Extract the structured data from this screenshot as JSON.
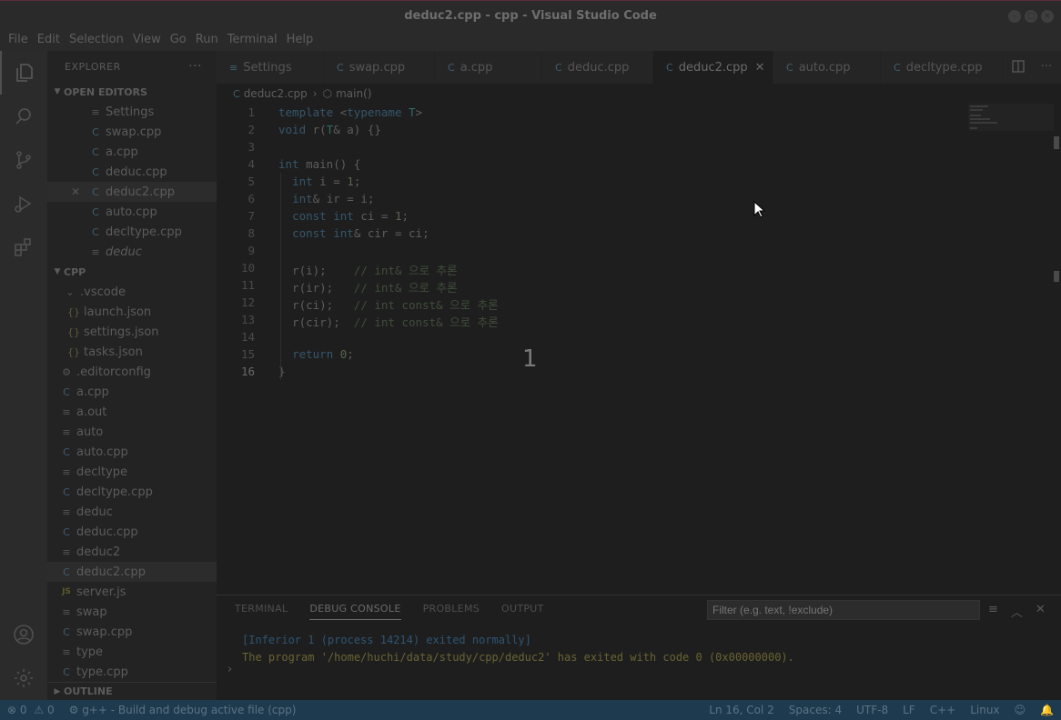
{
  "window": {
    "title": "deduc2.cpp - cpp - Visual Studio Code"
  },
  "menu": [
    "File",
    "Edit",
    "Selection",
    "View",
    "Go",
    "Run",
    "Terminal",
    "Help"
  ],
  "sidebar": {
    "header": "EXPLORER",
    "more": "···",
    "open_editors_title": "OPEN EDITORS",
    "open_editors": [
      {
        "label": "Settings",
        "icon": "settings-file-icon"
      },
      {
        "label": "swap.cpp",
        "icon": "cpp-icon"
      },
      {
        "label": "a.cpp",
        "icon": "cpp-icon"
      },
      {
        "label": "deduc.cpp",
        "icon": "cpp-icon"
      },
      {
        "label": "deduc2.cpp",
        "icon": "cpp-icon"
      },
      {
        "label": "auto.cpp",
        "icon": "cpp-icon"
      },
      {
        "label": "decltype.cpp",
        "icon": "cpp-icon"
      },
      {
        "label": "deduc",
        "icon": "file-icon"
      }
    ],
    "folder_title": "CPP",
    "vscode_folder": ".vscode",
    "files": [
      {
        "label": "launch.json",
        "icon": "json-icon",
        "indent": 2
      },
      {
        "label": "settings.json",
        "icon": "json-icon",
        "indent": 2
      },
      {
        "label": "tasks.json",
        "icon": "json-icon",
        "indent": 2
      },
      {
        "label": ".editorconfig",
        "icon": "gear-icon",
        "indent": 1
      },
      {
        "label": "a.cpp",
        "icon": "cpp-icon",
        "indent": 1
      },
      {
        "label": "a.out",
        "icon": "file-icon",
        "indent": 1
      },
      {
        "label": "auto",
        "icon": "file-icon",
        "indent": 1
      },
      {
        "label": "auto.cpp",
        "icon": "cpp-icon",
        "indent": 1
      },
      {
        "label": "decltype",
        "icon": "file-icon",
        "indent": 1
      },
      {
        "label": "decltype.cpp",
        "icon": "cpp-icon",
        "indent": 1
      },
      {
        "label": "deduc",
        "icon": "file-icon",
        "indent": 1
      },
      {
        "label": "deduc.cpp",
        "icon": "cpp-icon",
        "indent": 1
      },
      {
        "label": "deduc2",
        "icon": "file-icon",
        "indent": 1
      },
      {
        "label": "deduc2.cpp",
        "icon": "cpp-icon",
        "indent": 1
      },
      {
        "label": "server.js",
        "icon": "js-icon",
        "indent": 1
      },
      {
        "label": "swap",
        "icon": "file-icon",
        "indent": 1
      },
      {
        "label": "swap.cpp",
        "icon": "cpp-icon",
        "indent": 1
      },
      {
        "label": "type",
        "icon": "file-icon",
        "indent": 1
      },
      {
        "label": "type.cpp",
        "icon": "cpp-icon",
        "indent": 1
      }
    ],
    "outline_title": "OUTLINE"
  },
  "tabs": [
    {
      "label": "Settings",
      "icon": "settings-file-icon"
    },
    {
      "label": "swap.cpp",
      "icon": "cpp-icon"
    },
    {
      "label": "a.cpp",
      "icon": "cpp-icon"
    },
    {
      "label": "deduc.cpp",
      "icon": "cpp-icon"
    },
    {
      "label": "deduc2.cpp",
      "icon": "cpp-icon"
    },
    {
      "label": "auto.cpp",
      "icon": "cpp-icon"
    },
    {
      "label": "decltype.cpp",
      "icon": "cpp-icon"
    }
  ],
  "active_tab": "deduc2.cpp",
  "breadcrumb": {
    "file": "deduc2.cpp",
    "symbol": "main()"
  },
  "editor": {
    "lines": [
      "template <typename T>",
      "void r(T& a) {}",
      "",
      "int main() {",
      "  int i = 1;",
      "  int& ir = i;",
      "  const int ci = 1;",
      "  const int& cir = ci;",
      "",
      "  r(i);    // int& 으로 추론",
      "  r(ir);   // int& 으로 추론",
      "  r(ci);   // int const& 으로 추론",
      "  r(cir);  // int const& 으로 추론",
      "",
      "  return 0;",
      "}"
    ],
    "current_line": 16,
    "overlay_number": "1"
  },
  "panel": {
    "tabs": [
      "TERMINAL",
      "DEBUG CONSOLE",
      "PROBLEMS",
      "OUTPUT"
    ],
    "active_tab": "DEBUG CONSOLE",
    "filter_placeholder": "Filter (e.g. text, !exclude)",
    "lines": [
      "[Inferior 1 (process 14214) exited normally]",
      "The program '/home/huchi/data/study/cpp/deduc2' has exited with code 0 (0x00000000)."
    ]
  },
  "status": {
    "errors": "0",
    "warnings": "0",
    "task": "g++ - Build and debug active file (cpp)",
    "position": "Ln 16, Col 2",
    "spaces": "Spaces: 4",
    "encoding": "UTF-8",
    "eol": "LF",
    "language": "C++",
    "platform": "Linux"
  }
}
